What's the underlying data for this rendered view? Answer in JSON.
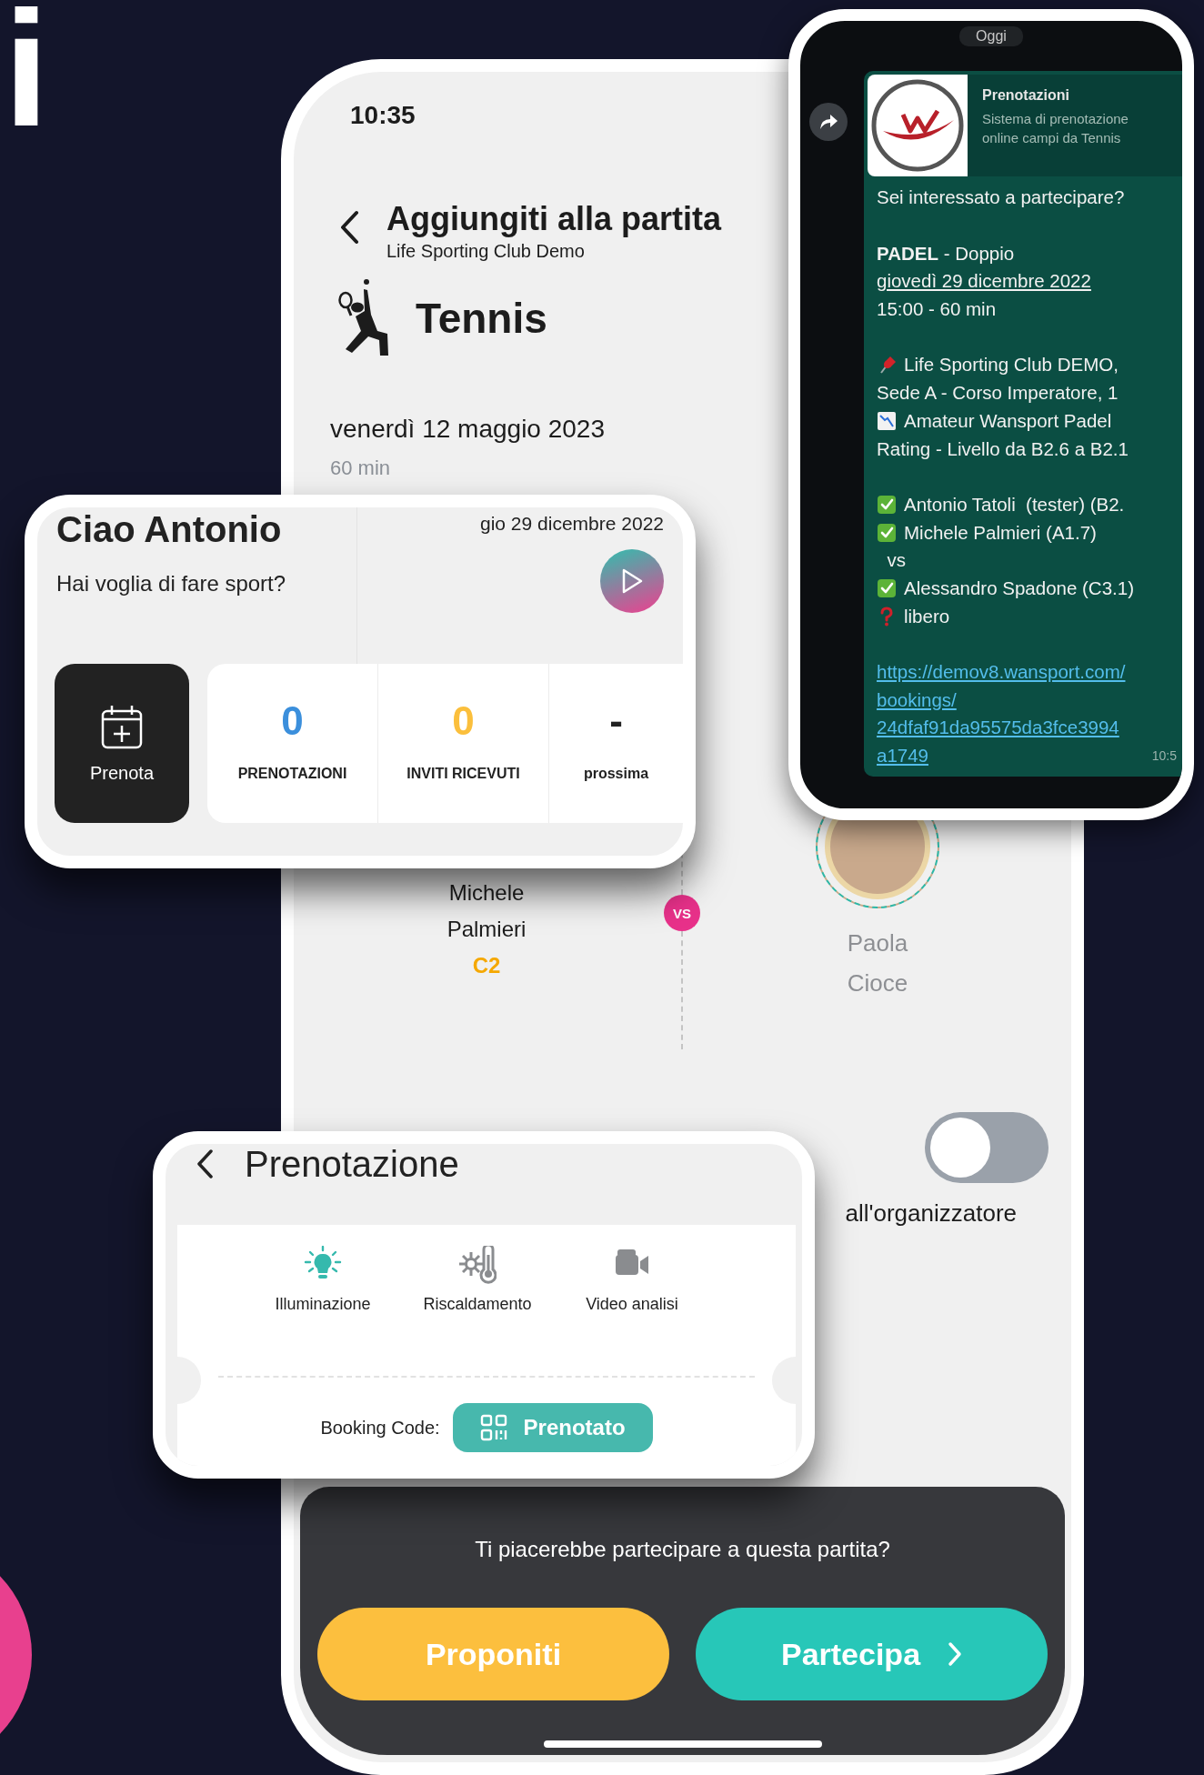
{
  "edge_letter": "i",
  "main_screen": {
    "status_time": "10:35",
    "title": "Aggiungiti alla partita",
    "club": "Life Sporting Club Demo",
    "sport": "Tennis",
    "date": "venerdì 12 maggio 2023",
    "duration": "60 min",
    "players": [
      {
        "name": "Michele Palmieri",
        "level": "C2",
        "kind": "confirmed"
      },
      {
        "name": "Paola Cioce",
        "kind": "invited"
      }
    ],
    "vs": "VS",
    "private_toggle": {
      "on": false
    },
    "toggle_caption": "all'organizzatore",
    "prompt": "Ti piacerebbe partecipare a questa partita?",
    "buttons": [
      {
        "label": "Proponiti",
        "kind": "secondary"
      },
      {
        "label": "Partecipa",
        "kind": "primary"
      }
    ]
  },
  "greeting_card": {
    "title": "Ciao Antonio",
    "date": "gio 29 dicembre 2022",
    "subtitle": "Hai voglia di fare sport?",
    "book_label": "Prenota",
    "stats": [
      {
        "value": "0",
        "label": "PRENOTAZIONI",
        "color": "#3b8fdc"
      },
      {
        "value": "0",
        "label": "INVITI RICEVUTI",
        "color": "#fbbf3c"
      },
      {
        "value": "-",
        "label": "prossima",
        "color": "#222222"
      }
    ]
  },
  "chat": {
    "day": "Oggi",
    "preview": {
      "title": "Prenotazioni",
      "description": "Sistema di prenotazione online campi da Tennis"
    },
    "paragraphs": [
      {
        "kind": "text",
        "lines": [
          {
            "text": "Sei interessato a partecipare?"
          }
        ]
      },
      {
        "kind": "text",
        "lines": [
          {
            "text": "**PADEL** - Doppio"
          },
          {
            "text": "giovedì 29 dicembre 2022",
            "underline": true
          },
          {
            "text": "15:00 - 60 min"
          }
        ]
      },
      {
        "kind": "text",
        "lines": [
          {
            "text": "Life Sporting Club DEMO,",
            "kind": "pin"
          },
          {
            "text": "Sede A - Corso Imperatore, 1"
          },
          {
            "text": "Amateur Wansport Padel",
            "kind": "chart"
          },
          {
            "text": "Rating - Livello da B2.6 a B2.1"
          }
        ]
      },
      {
        "kind": "text",
        "lines": [
          {
            "text": "Antonio Tatoli  (tester) (B2.",
            "kind": "check"
          },
          {
            "text": "Michele Palmieri (A1.7)",
            "kind": "check"
          },
          {
            "text": "  vs"
          },
          {
            "text": "Alessandro Spadone (C3.1)",
            "kind": "check"
          },
          {
            "text": "libero",
            "kind": "question"
          }
        ]
      },
      {
        "kind": "link",
        "lines": [
          {
            "text": "https://demov8.wansport.com/"
          },
          {
            "text": "bookings/"
          },
          {
            "text": "24dfaf91da95575da3fce3994"
          },
          {
            "text": "a1749"
          }
        ]
      }
    ],
    "time": "10:5"
  },
  "booking_card": {
    "title": "Prenotazione",
    "amenities": [
      {
        "label": "Illuminazione",
        "kind": "light",
        "on": true
      },
      {
        "label": "Riscaldamento",
        "kind": "heating",
        "on": false
      },
      {
        "label": "Video analisi",
        "kind": "video",
        "on": false
      }
    ],
    "code_label": "Booking Code:",
    "status": "Prenotato"
  }
}
